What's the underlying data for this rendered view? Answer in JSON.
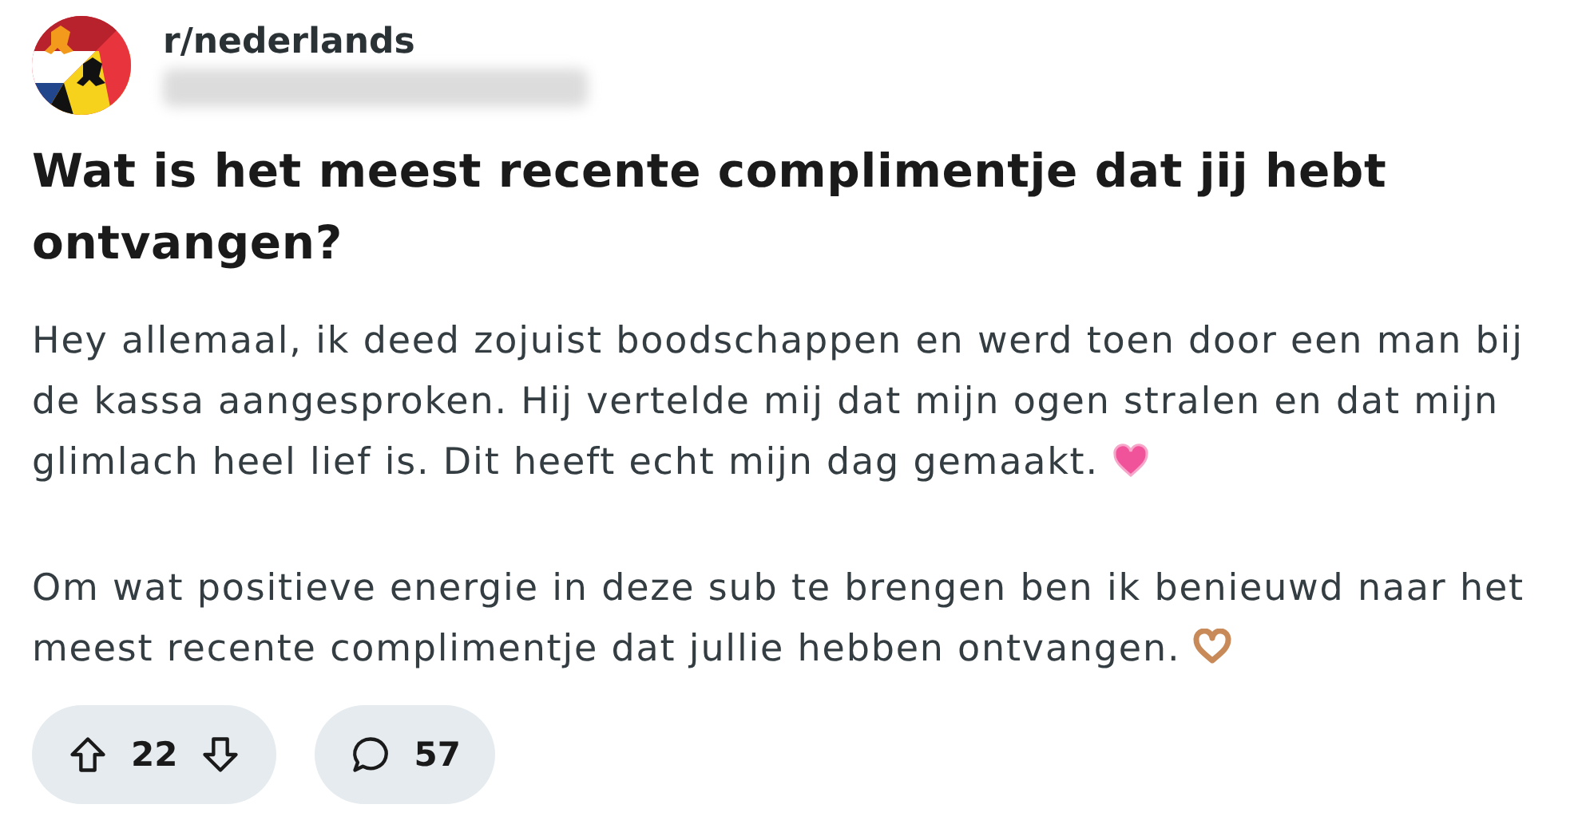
{
  "post": {
    "subreddit": "r/nederlands",
    "title": "Wat is het meest recente complimentje dat jij hebt ontvangen?",
    "paragraphs": [
      {
        "text": "Hey allemaal, ik deed zojuist boodschappen en werd toen door een man bij de kassa aangesproken. Hij vertelde mij dat mijn ogen stralen en dat mijn glimlach heel lief is. Dit heeft echt mijn dag gemaakt.",
        "kind": "heart-end"
      },
      {
        "text": "Om wat positieve energie in deze sub te brengen ben ik benieuwd naar het meest recente complimentje dat jullie hebben ontvangen.",
        "kind": "hands-end"
      }
    ],
    "votes": "22",
    "comments": "57"
  }
}
